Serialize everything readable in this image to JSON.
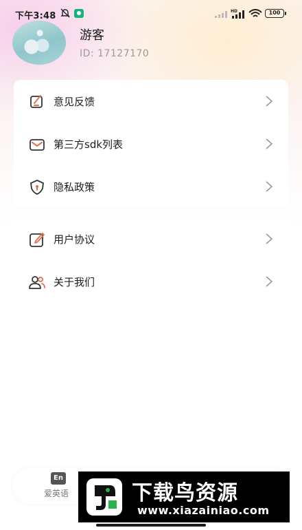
{
  "status_bar": {
    "time": "下午3:48",
    "battery": "100",
    "icons": [
      "bell-muted-icon",
      "app-notification-icon",
      "signal-icon",
      "hd-signal-icon",
      "wifi-icon",
      "battery-icon"
    ]
  },
  "profile": {
    "name": "游客",
    "id": "ID: 17127170"
  },
  "menu_groups": [
    {
      "items": [
        {
          "label": "意见反馈",
          "icon": "feedback-icon",
          "accent": "#e2704f"
        },
        {
          "label": "第三方sdk列表",
          "icon": "mail-icon",
          "accent": "#e2704f"
        },
        {
          "label": "隐私政策",
          "icon": "shield-icon",
          "accent": "#e2704f"
        }
      ]
    },
    {
      "items": [
        {
          "label": "用户协议",
          "icon": "edit-icon",
          "accent": "#e2704f"
        },
        {
          "label": "关于我们",
          "icon": "users-icon",
          "accent": "#e2704f"
        }
      ]
    }
  ],
  "bottom_nav": {
    "tabs": [
      {
        "label": "爱英语",
        "icon": "En"
      }
    ]
  },
  "watermark": {
    "title": "下载鸟资源",
    "url": "www.xiazainiao.com"
  }
}
